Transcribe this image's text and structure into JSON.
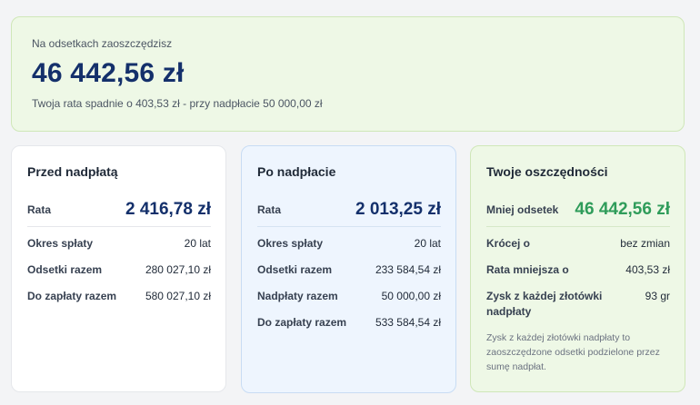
{
  "summary": {
    "label": "Na odsetkach zaoszczędzisz",
    "amount": "46 442,56 zł",
    "subtitle": "Twoja rata spadnie o 403,53 zł - przy nadpłacie 50 000,00 zł"
  },
  "before": {
    "title": "Przed nadpłatą",
    "rate_label": "Rata",
    "rate_value": "2 416,78 zł",
    "rows": [
      {
        "label": "Okres spłaty",
        "value": "20 lat"
      },
      {
        "label": "Odsetki razem",
        "value": "280 027,10 zł"
      },
      {
        "label": "Do zapłaty razem",
        "value": "580 027,10 zł"
      }
    ]
  },
  "after": {
    "title": "Po nadpłacie",
    "rate_label": "Rata",
    "rate_value": "2 013,25 zł",
    "rows": [
      {
        "label": "Okres spłaty",
        "value": "20 lat"
      },
      {
        "label": "Odsetki razem",
        "value": "233 584,54 zł"
      },
      {
        "label": "Nadpłaty razem",
        "value": "50 000,00 zł"
      },
      {
        "label": "Do zapłaty razem",
        "value": "533 584,54 zł"
      }
    ]
  },
  "savings": {
    "title": "Twoje oszczędności",
    "rate_label": "Mniej odsetek",
    "rate_value": "46 442,56 zł",
    "rows": [
      {
        "label": "Krócej o",
        "value": "bez zmian"
      },
      {
        "label": "Rata mniejsza o",
        "value": "403,53 zł"
      },
      {
        "label": "Zysk z każdej złotówki nadpłaty",
        "value": "93 gr"
      }
    ],
    "note": "Zysk z każdej złotówki nadpłaty to zaoszczędzone odsetki podzielone przez sumę nadpłat.",
    "accent_color": "#2f9c5a"
  },
  "colors": {
    "navy": "#14306b",
    "green_bg": "#eef8e6",
    "blue_bg": "#eef5fe"
  }
}
